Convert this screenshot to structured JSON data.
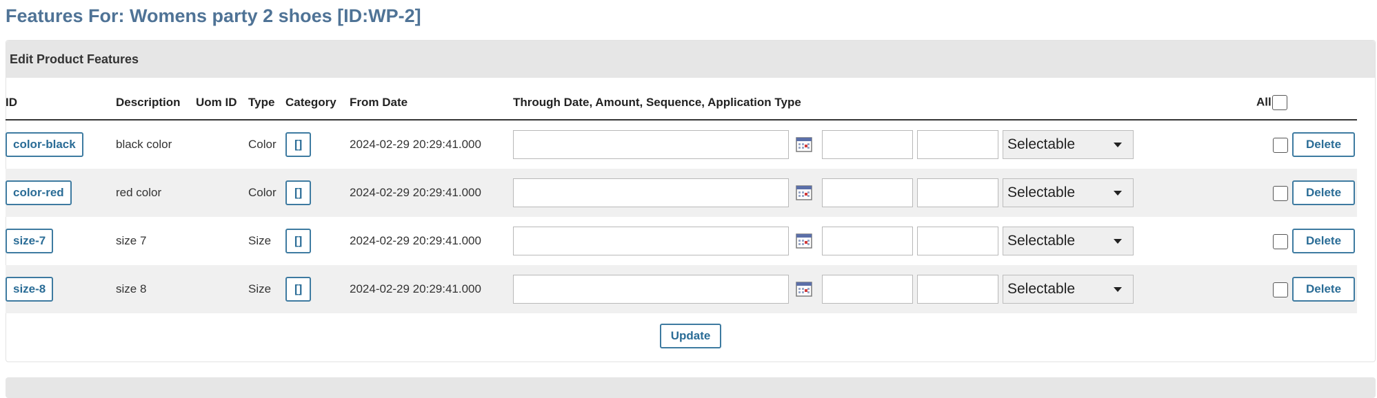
{
  "page": {
    "title": "Features For: Womens party 2 shoes [ID:WP-2]"
  },
  "panel": {
    "header": "Edit Product Features"
  },
  "table": {
    "headers": {
      "id": "ID",
      "description": "Description",
      "uom": "Uom ID",
      "type": "Type",
      "category": "Category",
      "from_date": "From Date",
      "through": "Through Date, Amount, Sequence, Application Type",
      "all": "All"
    },
    "rows": [
      {
        "id": "color-black",
        "description": "black color",
        "uom": "",
        "type": "Color",
        "category": "[]",
        "from_date": "2024-02-29 20:29:41.000",
        "through_date": "",
        "amount": "",
        "sequence": "",
        "application_type": "Selectable",
        "delete": "Delete"
      },
      {
        "id": "color-red",
        "description": "red color",
        "uom": "",
        "type": "Color",
        "category": "[]",
        "from_date": "2024-02-29 20:29:41.000",
        "through_date": "",
        "amount": "",
        "sequence": "",
        "application_type": "Selectable",
        "delete": "Delete"
      },
      {
        "id": "size-7",
        "description": "size 7",
        "uom": "",
        "type": "Size",
        "category": "[]",
        "from_date": "2024-02-29 20:29:41.000",
        "through_date": "",
        "amount": "",
        "sequence": "",
        "application_type": "Selectable",
        "delete": "Delete"
      },
      {
        "id": "size-8",
        "description": "size 8",
        "uom": "",
        "type": "Size",
        "category": "[]",
        "from_date": "2024-02-29 20:29:41.000",
        "through_date": "",
        "amount": "",
        "sequence": "",
        "application_type": "Selectable",
        "delete": "Delete"
      }
    ]
  },
  "actions": {
    "update": "Update"
  },
  "colors": {
    "title": "#4f7396",
    "button_border": "#3d7aa0",
    "button_text": "#2a6c96",
    "header_bg": "#e6e6e6",
    "alt_row_bg": "#f0f0f0"
  },
  "icons": {
    "calendar": "calendar-icon",
    "dropdown": "chevron-down-icon"
  }
}
